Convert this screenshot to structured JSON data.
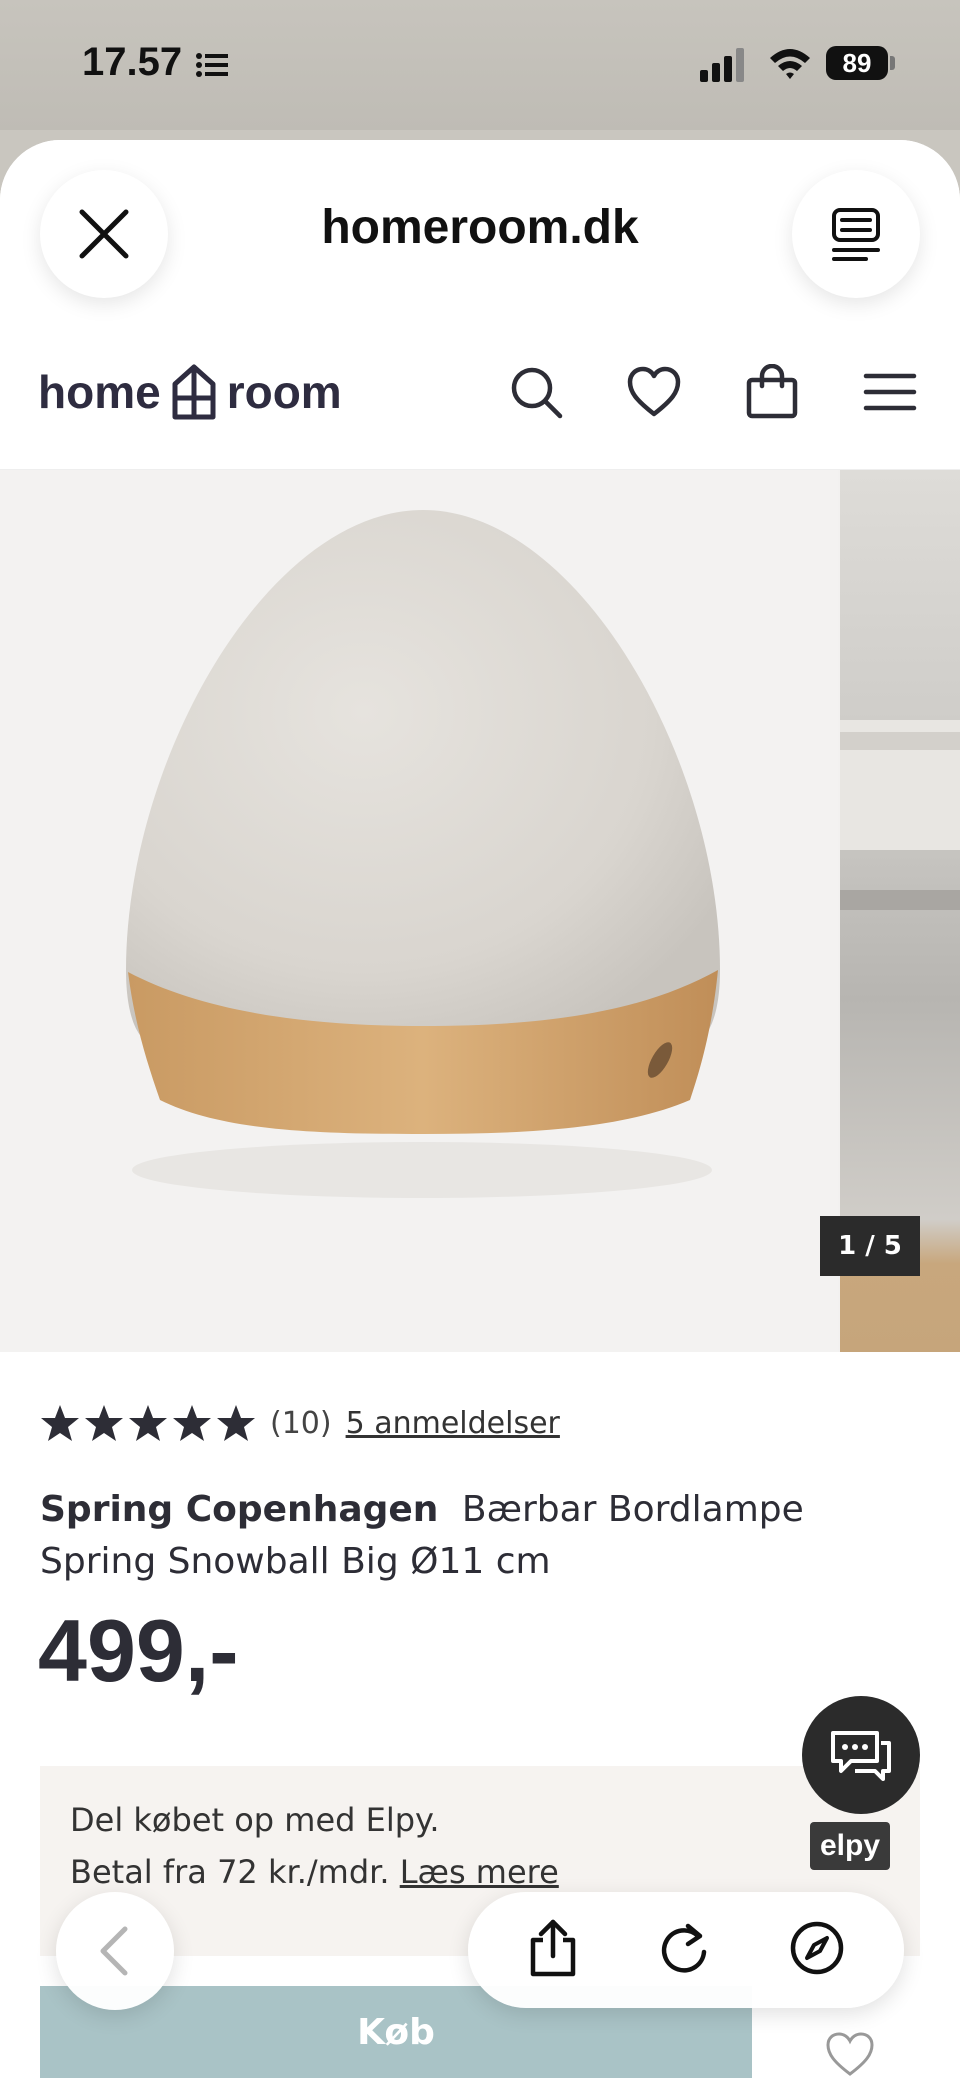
{
  "status_bar": {
    "time": "17.57",
    "battery": "89"
  },
  "browser": {
    "url": "homeroom.dk"
  },
  "site": {
    "logo_left": "home",
    "logo_right": "room"
  },
  "gallery": {
    "counter": "1 / 5"
  },
  "product": {
    "rating_count": "(10)",
    "reviews_link": "5 anmeldelser",
    "stars": 5,
    "brand": "Spring Copenhagen",
    "name": "Bærbar Bordlampe Spring Snowball Big Ø11 cm",
    "price": "499,-"
  },
  "elpy": {
    "line1": "Del købet op med Elpy.",
    "line2": "Betal fra 72 kr./mdr.",
    "link": "Læs mere",
    "badge": "elpy"
  },
  "buy_button": {
    "label": "Køb"
  },
  "icons": {
    "close": "close-icon",
    "reader": "reader-icon",
    "search": "search-icon",
    "wishlist": "heart-icon",
    "bag": "bag-icon",
    "menu": "menu-icon",
    "chat": "chat-icon",
    "back": "chevron-left-icon",
    "share": "share-icon",
    "reload": "reload-icon",
    "compass": "compass-icon"
  },
  "colors": {
    "text": "#2d2d36",
    "buy_button": "#a9c3c6",
    "elpy_bg": "#f6f3f0",
    "dark": "#2b2b2b"
  }
}
